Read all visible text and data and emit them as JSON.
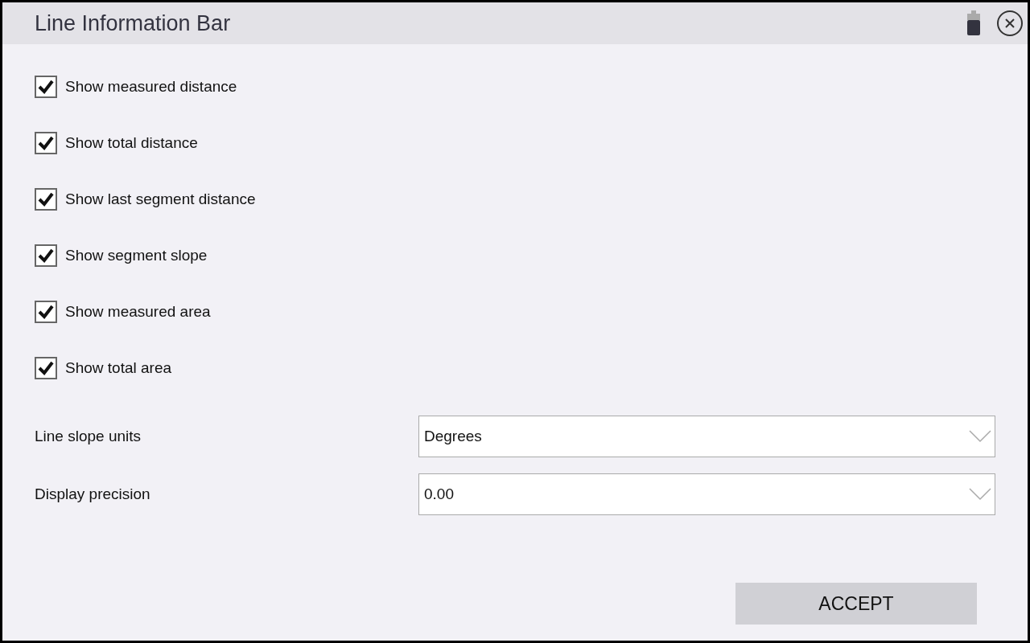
{
  "window": {
    "title": "Line Information Bar"
  },
  "options": [
    {
      "label": "Show measured distance",
      "checked": true
    },
    {
      "label": "Show total distance",
      "checked": true
    },
    {
      "label": "Show last segment distance",
      "checked": true
    },
    {
      "label": "Show segment slope",
      "checked": true
    },
    {
      "label": "Show measured area",
      "checked": true
    },
    {
      "label": "Show total area",
      "checked": true
    }
  ],
  "settings": [
    {
      "label": "Line slope units",
      "value": "Degrees"
    },
    {
      "label": "Display precision",
      "value": "0.00"
    }
  ],
  "buttons": [
    "ACCEPT"
  ]
}
